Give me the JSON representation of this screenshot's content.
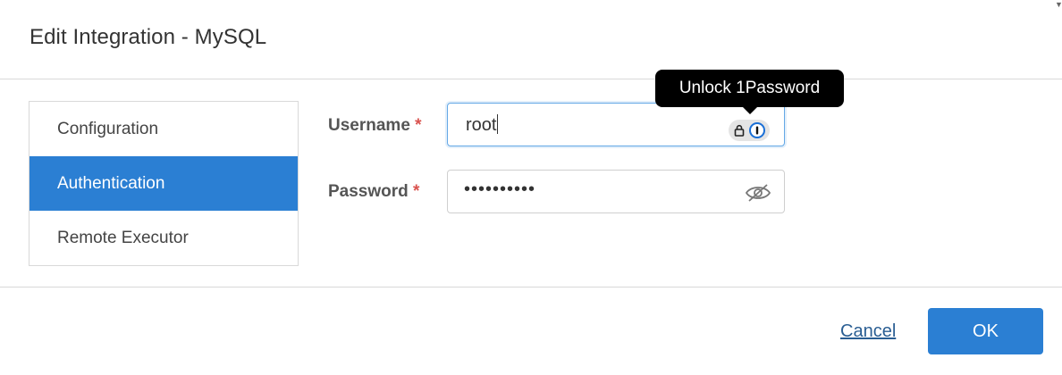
{
  "dialog": {
    "title": "Edit Integration - MySQL"
  },
  "nav": {
    "items": [
      {
        "label": "Configuration",
        "active": false
      },
      {
        "label": "Authentication",
        "active": true
      },
      {
        "label": "Remote Executor",
        "active": false
      }
    ]
  },
  "form": {
    "username": {
      "label": "Username",
      "required_mark": "*",
      "value": "root"
    },
    "password": {
      "label": "Password",
      "required_mark": "*",
      "masked_value": "••••••••••"
    }
  },
  "tooltip": {
    "text": "Unlock 1Password"
  },
  "footer": {
    "cancel_label": "Cancel",
    "ok_label": "OK"
  },
  "colors": {
    "accent": "#2b7fd3",
    "required": "#d9534f",
    "link": "#2a5e93"
  },
  "icons": [
    "lock-icon",
    "onepassword-icon",
    "eye-slash-icon"
  ]
}
